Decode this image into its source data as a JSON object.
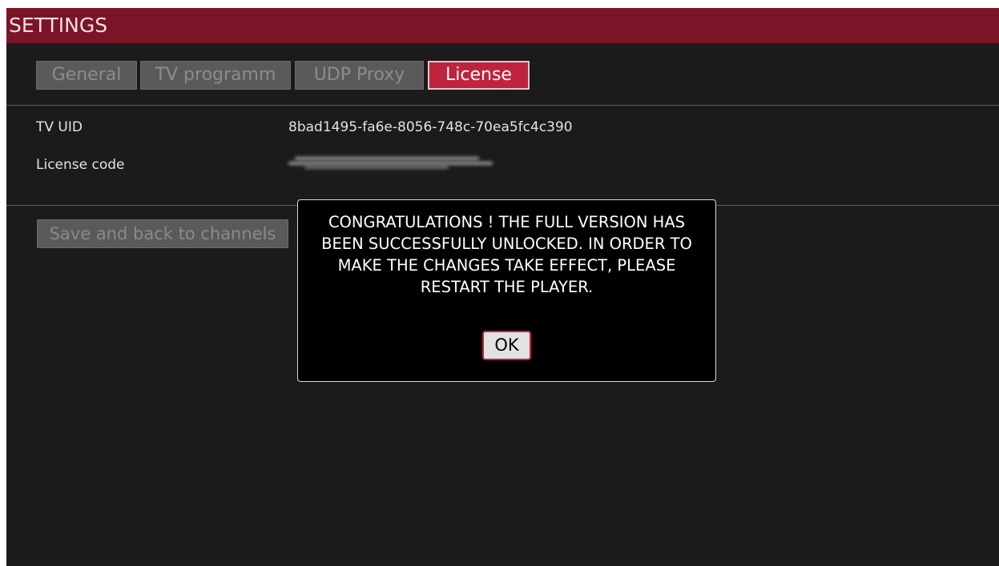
{
  "header": {
    "title": "SETTINGS"
  },
  "tabs": [
    {
      "label": "General",
      "active": false
    },
    {
      "label": "TV programm",
      "active": false
    },
    {
      "label": "UDP Proxy",
      "active": false
    },
    {
      "label": "License",
      "active": true
    }
  ],
  "license": {
    "tv_uid_label": "TV UID",
    "tv_uid_value": "8bad1495-fa6e-8056-748c-70ea5fc4c390",
    "code_label": "License code"
  },
  "actions": {
    "save_label": "Save and back to channels"
  },
  "dialog": {
    "message": "CONGRATULATIONS ! THE FULL VERSION HAS BEEN SUCCESSFULLY UNLOCKED. IN ORDER TO MAKE THE CHANGES TAKE EFFECT, PLEASE RESTART THE PLAYER.",
    "ok_label": "OK"
  },
  "colors": {
    "accent": "#c0233d",
    "header_bg": "#7c1427",
    "background": "#1b1b1b"
  }
}
